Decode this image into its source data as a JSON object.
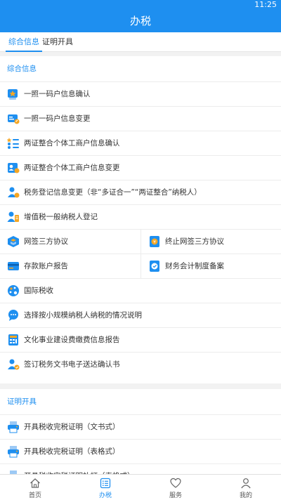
{
  "status": {
    "time": "11:25"
  },
  "header": {
    "title": "办税"
  },
  "tabs": [
    {
      "label": "综合信息",
      "active": true
    },
    {
      "label": "证明开具",
      "active": false
    }
  ],
  "sections": {
    "general": {
      "title": "综合信息",
      "items": [
        {
          "label": "一照一码户信息确认",
          "icon": "license-confirm-icon"
        },
        {
          "label": "一照一码户信息变更",
          "icon": "license-edit-icon"
        },
        {
          "label": "两证整合个体工商户信息确认",
          "icon": "list-star-icon"
        },
        {
          "label": "两证整合个体工商户信息变更",
          "icon": "id-card-edit-icon"
        },
        {
          "label": "税务登记信息变更（非“多证合一”“两证整合”纳税人）",
          "icon": "user-edit-icon"
        },
        {
          "label": "增值税一般纳税人登记",
          "icon": "user-register-icon"
        },
        {
          "label": "网签三方协议",
          "icon": "agreement-icon"
        },
        {
          "label": "终止网签三方协议",
          "icon": "terminate-agreement-icon"
        },
        {
          "label": "存款账户报告",
          "icon": "bank-card-icon"
        },
        {
          "label": "财务会计制度备案",
          "icon": "accounting-icon"
        },
        {
          "label": "国际税收",
          "icon": "globe-palette-icon"
        },
        {
          "label": "选择按小规模纳税人纳税的情况说明",
          "icon": "chat-bubble-icon"
        },
        {
          "label": "文化事业建设费缴费信息报告",
          "icon": "calculator-icon"
        },
        {
          "label": "签订税务文书电子送达确认书",
          "icon": "user-sign-icon"
        }
      ]
    },
    "certificate": {
      "title": "证明开具",
      "items": [
        {
          "label": "开具税收完税证明（文书式）",
          "icon": "printer-icon"
        },
        {
          "label": "开具税收完税证明（表格式）",
          "icon": "printer-icon"
        },
        {
          "label": "开具税收完税证明补打（表格式）",
          "icon": "printer-icon"
        }
      ]
    }
  },
  "nav": [
    {
      "label": "首页",
      "icon": "home-icon",
      "active": false
    },
    {
      "label": "办税",
      "icon": "tax-list-icon",
      "active": true
    },
    {
      "label": "服务",
      "icon": "heart-icon",
      "active": false
    },
    {
      "label": "我的",
      "icon": "person-icon",
      "active": false
    }
  ],
  "colors": {
    "primary": "#1e8ff0",
    "orange": "#f5a623",
    "background": "#f2f2f2"
  }
}
